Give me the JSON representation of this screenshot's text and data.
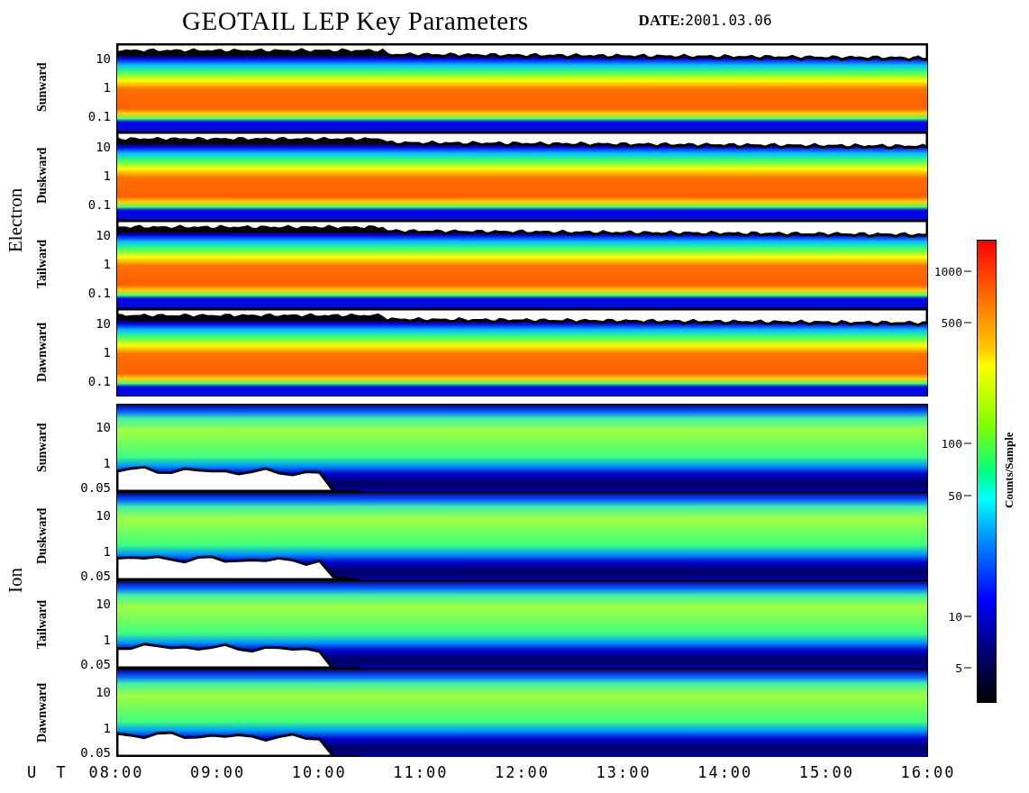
{
  "title": "GEOTAIL LEP Key Parameters",
  "date": {
    "label": "DATE:",
    "value": "2001.03.06"
  },
  "groups": [
    {
      "name": "Electron",
      "kind": "electron",
      "panels": [
        {
          "label": "Sunward",
          "yticks": [
            "10",
            "1",
            "0.1"
          ]
        },
        {
          "label": "Duskward",
          "yticks": [
            "10",
            "1",
            "0.1"
          ]
        },
        {
          "label": "Tailward",
          "yticks": [
            "10",
            "1",
            "0.1"
          ]
        },
        {
          "label": "Dawnward",
          "yticks": [
            "10",
            "1",
            "0.1"
          ]
        }
      ]
    },
    {
      "name": "Ion",
      "kind": "ion",
      "panels": [
        {
          "label": "Sunward",
          "yticks": [
            "10",
            "1",
            "0.05"
          ]
        },
        {
          "label": "Duskward",
          "yticks": [
            "10",
            "1",
            "0.05"
          ]
        },
        {
          "label": "Tailward",
          "yticks": [
            "10",
            "1",
            "0.05"
          ]
        },
        {
          "label": "Dawnward",
          "yticks": [
            "10",
            "1",
            "0.05"
          ]
        }
      ]
    }
  ],
  "time_axis": {
    "label": "U T",
    "ticks": [
      "08:00",
      "09:00",
      "10:00",
      "11:00",
      "12:00",
      "13:00",
      "14:00",
      "15:00",
      "16:00"
    ]
  },
  "colorbar": {
    "label": "Counts/Sample",
    "ticks": [
      "1000",
      "500",
      "100",
      "50",
      "10",
      "5"
    ]
  }
}
